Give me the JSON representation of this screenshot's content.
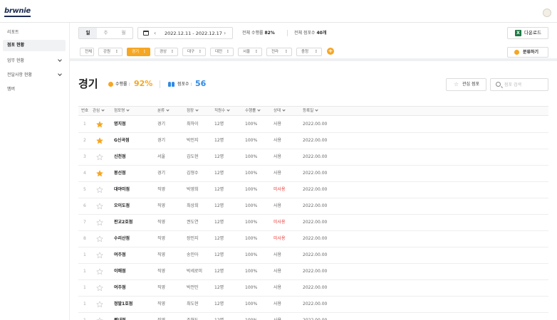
{
  "header": {
    "logo_text": "brwnie"
  },
  "sidebar": {
    "items": [
      {
        "label": "리포트",
        "active": false,
        "has_caret": false
      },
      {
        "label": "점포 현황",
        "active": true,
        "has_caret": false
      },
      {
        "label": "업무 현황",
        "active": false,
        "has_caret": true
      },
      {
        "label": "전달사항 현황",
        "active": false,
        "has_caret": true
      },
      {
        "label": "멤버",
        "active": false,
        "has_caret": false
      }
    ]
  },
  "toolbar": {
    "period_tabs": [
      "일",
      "주",
      "월"
    ],
    "date_range": "2022.12.11 - 2022.12.17",
    "prev_icon": "‹",
    "next_icon": "›",
    "total_rate_label": "전체 수행률",
    "total_rate_value": "82%",
    "total_store_label": "전체 점포수",
    "total_store_value": "40개",
    "download_label": "다운로드",
    "download_icon": "X",
    "sort_label": "분류하기"
  },
  "filters": {
    "chips": [
      "전체",
      "강원",
      "경기",
      "경상",
      "대구",
      "대전",
      "서울",
      "전라",
      "충청"
    ],
    "active": "경기",
    "add_icon": "+"
  },
  "region_header": {
    "title": "경기",
    "rate_label": "수행률 :",
    "rate_value": "92%",
    "count_label": "점포수 :",
    "count_value": "56",
    "favorite_button": "관심 점포",
    "search_placeholder": "점포 검색"
  },
  "table": {
    "columns": [
      "번호",
      "관심",
      "점포명",
      "분류",
      "점장",
      "직원수",
      "수행률",
      "상태",
      "등록일"
    ],
    "rows": [
      {
        "no": "1",
        "fav": true,
        "name": "명지점",
        "type": "경기",
        "manager": "최하이",
        "staff": "12명",
        "rate": "100%",
        "status": "사용",
        "date": "2022.00.00"
      },
      {
        "no": "2",
        "fav": true,
        "name": "G신곡점",
        "type": "경기",
        "manager": "박민지",
        "staff": "12명",
        "rate": "100%",
        "status": "사용",
        "date": "2022.00.00"
      },
      {
        "no": "3",
        "fav": false,
        "name": "신천점",
        "type": "서울",
        "manager": "김도현",
        "staff": "12명",
        "rate": "100%",
        "status": "사용",
        "date": "2022.00.00"
      },
      {
        "no": "4",
        "fav": true,
        "name": "봉선점",
        "type": "경기",
        "manager": "김형수",
        "staff": "12명",
        "rate": "100%",
        "status": "사용",
        "date": "2022.00.00"
      },
      {
        "no": "5",
        "fav": false,
        "name": "대야미점",
        "type": "직영",
        "manager": "박영희",
        "staff": "12명",
        "rate": "100%",
        "status": "미사용",
        "date": "2022.00.00"
      },
      {
        "no": "6",
        "fav": false,
        "name": "오이도점",
        "type": "직영",
        "manager": "최상희",
        "staff": "12명",
        "rate": "100%",
        "status": "사용",
        "date": "2022.00.00"
      },
      {
        "no": "7",
        "fav": false,
        "name": "판교2호점",
        "type": "직영",
        "manager": "권도연",
        "staff": "12명",
        "rate": "100%",
        "status": "미사용",
        "date": "2022.00.00"
      },
      {
        "no": "8",
        "fav": false,
        "name": "수리산점",
        "type": "직영",
        "manager": "장민지",
        "staff": "12명",
        "rate": "100%",
        "status": "미사용",
        "date": "2022.00.00"
      },
      {
        "no": "1",
        "fav": false,
        "name": "여주점",
        "type": "직영",
        "manager": "송민아",
        "staff": "12명",
        "rate": "100%",
        "status": "사용",
        "date": "2022.00.00"
      },
      {
        "no": "1",
        "fav": false,
        "name": "이매점",
        "type": "직영",
        "manager": "박세로미",
        "staff": "12명",
        "rate": "100%",
        "status": "사용",
        "date": "2022.00.00"
      },
      {
        "no": "1",
        "fav": false,
        "name": "여주점",
        "type": "직영",
        "manager": "박전민",
        "staff": "12명",
        "rate": "100%",
        "status": "사용",
        "date": "2022.00.00"
      },
      {
        "no": "1",
        "fav": false,
        "name": "정발1호점",
        "type": "직영",
        "manager": "최도현",
        "staff": "12명",
        "rate": "100%",
        "status": "사용",
        "date": "2022.00.00"
      },
      {
        "no": "1",
        "fav": false,
        "name": "평내점",
        "type": "직영",
        "manager": "조현도",
        "staff": "12명",
        "rate": "100%",
        "status": "사용",
        "date": "2022.00.00"
      }
    ]
  },
  "colors": {
    "accent": "#f5a623",
    "blue": "#2e8ae6",
    "danger": "#e53935",
    "excel": "#1f7a44"
  }
}
